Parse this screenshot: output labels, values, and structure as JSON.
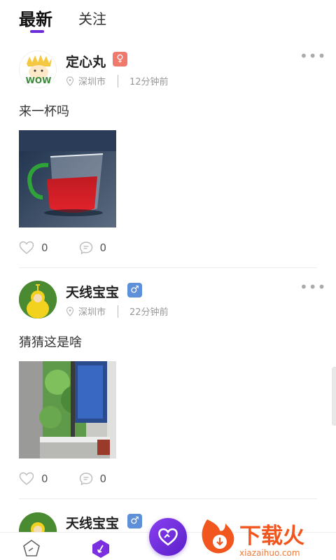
{
  "tabs": {
    "latest": "最新",
    "following": "关注"
  },
  "posts": [
    {
      "username": "定心丸",
      "gender": "female",
      "gender_glyph": "♀",
      "location": "深圳市",
      "time": "12分钟前",
      "content": "来一杯吗",
      "likes": "0",
      "comments": "0",
      "avatar_text": "WOW"
    },
    {
      "username": "天线宝宝",
      "gender": "male",
      "gender_glyph": "♂",
      "location": "深圳市",
      "time": "22分钟前",
      "content": "猜猜这是啥",
      "likes": "0",
      "comments": "0"
    },
    {
      "username": "天线宝宝",
      "gender": "male",
      "gender_glyph": "♂"
    }
  ],
  "more_glyph": "•••",
  "watermark": {
    "brand": "下载火",
    "url": "xiazaihuo.com"
  },
  "icons": [
    "more-icon",
    "location-pin-icon",
    "heart-icon",
    "comment-icon",
    "home-icon",
    "discover-icon",
    "heart-publish-icon"
  ],
  "colors": {
    "accent": "#6c2bd9",
    "female_badge": "#ef7a6b",
    "male_badge": "#5e8fd9"
  }
}
